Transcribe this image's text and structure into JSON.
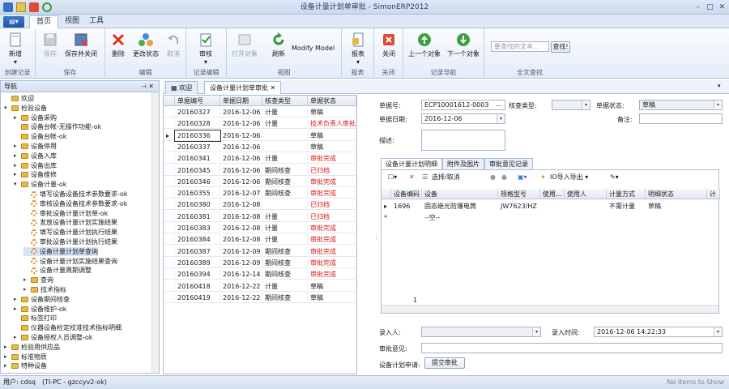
{
  "window": {
    "title": "设备计量计划单审批 - SimonERP2012"
  },
  "menu": {
    "tabs": [
      "首页",
      "视图",
      "工具"
    ]
  },
  "ribbon": {
    "groups": [
      {
        "title": "创建记录",
        "buttons": [
          {
            "label": "新增",
            "enabled": true,
            "icon": "new-doc-icon"
          }
        ]
      },
      {
        "title": "保存",
        "buttons": [
          {
            "label": "保存",
            "enabled": false,
            "icon": "floppy-icon"
          },
          {
            "label": "保存并关闭",
            "enabled": true,
            "icon": "save-close-icon"
          }
        ]
      },
      {
        "title": "编辑",
        "buttons": [
          {
            "label": "删除",
            "enabled": true,
            "icon": "delete-x-icon"
          },
          {
            "label": "更改状态",
            "enabled": true,
            "icon": "status-icon"
          },
          {
            "label": "取消",
            "enabled": false,
            "icon": "undo-icon"
          }
        ]
      },
      {
        "title": "记录编辑",
        "buttons": [
          {
            "label": "审核",
            "enabled": true,
            "icon": "audit-icon"
          }
        ]
      },
      {
        "title": "视图",
        "buttons": [
          {
            "label": "打开对象",
            "enabled": false,
            "icon": "open-object-icon"
          },
          {
            "label": "刷新",
            "enabled": true,
            "icon": "refresh-icon"
          },
          {
            "label": "Modify Model",
            "enabled": true,
            "icon": ""
          }
        ]
      },
      {
        "title": "报表",
        "buttons": [
          {
            "label": "报表",
            "enabled": true,
            "icon": "report-icon"
          }
        ]
      },
      {
        "title": "关闭",
        "buttons": [
          {
            "label": "关闭",
            "enabled": true,
            "icon": "close-red-icon"
          }
        ]
      },
      {
        "title": "记录导航",
        "buttons": [
          {
            "label": "上一个对象",
            "enabled": true,
            "icon": "up-arrow-icon"
          },
          {
            "label": "下一个对象",
            "enabled": true,
            "icon": "down-arrow-icon"
          }
        ]
      },
      {
        "title": "全文查找",
        "buttons": [
          {
            "label": "查找!",
            "enabled": true,
            "icon": ""
          }
        ]
      }
    ],
    "search_placeholder": "要查找的文本..."
  },
  "nav": {
    "title": "导航",
    "items": [
      {
        "label": "欢迎",
        "depth": 0,
        "kind": "folder",
        "exp": ""
      },
      {
        "label": "检验设备",
        "depth": 0,
        "kind": "folder",
        "exp": "▾"
      },
      {
        "label": "设备采购",
        "depth": 1,
        "kind": "folder",
        "exp": "▸"
      },
      {
        "label": "设备台帐-无操作功能-ok",
        "depth": 1,
        "kind": "folder",
        "exp": ""
      },
      {
        "label": "设备台帐-ok",
        "depth": 1,
        "kind": "folder",
        "exp": ""
      },
      {
        "label": "设备停用",
        "depth": 1,
        "kind": "folder",
        "exp": "▸"
      },
      {
        "label": "设备入库",
        "depth": 1,
        "kind": "folder",
        "exp": "▸"
      },
      {
        "label": "设备出库",
        "depth": 1,
        "kind": "folder",
        "exp": "▸"
      },
      {
        "label": "设备维修",
        "depth": 1,
        "kind": "folder",
        "exp": "▸"
      },
      {
        "label": "设备计量-ok",
        "depth": 1,
        "kind": "folder",
        "exp": "▾"
      },
      {
        "label": "填写设备设备技术参数要求-ok",
        "depth": 2,
        "kind": "gear",
        "exp": ""
      },
      {
        "label": "审核设备设备技术参数要求-ok",
        "depth": 2,
        "kind": "gear",
        "exp": ""
      },
      {
        "label": "审批设备计量计划单-ok",
        "depth": 2,
        "kind": "gear",
        "exp": ""
      },
      {
        "label": "发放设备计量计划实施结果",
        "depth": 2,
        "kind": "gear",
        "exp": ""
      },
      {
        "label": "填写设备计量计划执行结果",
        "depth": 2,
        "kind": "gear",
        "exp": ""
      },
      {
        "label": "审批设备计量计划执行结果",
        "depth": 2,
        "kind": "gear",
        "exp": ""
      },
      {
        "label": "设备计量计划单查询",
        "depth": 2,
        "kind": "gear",
        "exp": "",
        "selected": true
      },
      {
        "label": "设备计量计划实施结果查询",
        "depth": 2,
        "kind": "gear",
        "exp": ""
      },
      {
        "label": "设备计量周期调整",
        "depth": 2,
        "kind": "gear",
        "exp": ""
      },
      {
        "label": "查询",
        "depth": 2,
        "kind": "folder",
        "exp": "▸"
      },
      {
        "label": "技术指标",
        "depth": 2,
        "kind": "folder",
        "exp": "▸"
      },
      {
        "label": "设备期间核查",
        "depth": 1,
        "kind": "folder",
        "exp": "▸"
      },
      {
        "label": "设备维护-ok",
        "depth": 1,
        "kind": "folder",
        "exp": "▸"
      },
      {
        "label": "标签打印",
        "depth": 1,
        "kind": "folder",
        "exp": ""
      },
      {
        "label": "仪器设备检定校准技术指标明细",
        "depth": 1,
        "kind": "folder",
        "exp": ""
      },
      {
        "label": "设备授权人员调整-ok",
        "depth": 1,
        "kind": "folder",
        "exp": "▸"
      },
      {
        "label": "检验用供应品",
        "depth": 0,
        "kind": "folder",
        "exp": "▸"
      },
      {
        "label": "标准物质",
        "depth": 0,
        "kind": "folder",
        "exp": "▸"
      },
      {
        "label": "特种设备",
        "depth": 0,
        "kind": "folder",
        "exp": "▸"
      }
    ]
  },
  "doc_tabs": [
    {
      "label": "欢迎",
      "active": false
    },
    {
      "label": "设备计量计划单审批",
      "active": true
    }
  ],
  "grid": {
    "columns": [
      "单据编号",
      "单据日期",
      "核查类型",
      "单据状态"
    ],
    "rows": [
      [
        "20160327",
        "2016-12-06",
        "计量",
        "草稿"
      ],
      [
        "20160328",
        "2016-12-06",
        "计量",
        "技术负责人审批"
      ],
      [
        "20160336",
        "2016-12-06",
        "",
        "草稿"
      ],
      [
        "20160337",
        "2016-12-06",
        "",
        "草稿"
      ],
      [
        "20160341",
        "2016-12-06",
        "计量",
        "审批完成"
      ],
      [
        "20160345",
        "2016-12-06",
        "期间核查",
        "已归档"
      ],
      [
        "20160346",
        "2016-12-06",
        "期间核查",
        "审批完成"
      ],
      [
        "20160355",
        "2016-12-07",
        "期间核查",
        "审批完成"
      ],
      [
        "20160380",
        "2016-12-08",
        "",
        "已归档"
      ],
      [
        "20160381",
        "2016-12-08",
        "计量",
        "已归档"
      ],
      [
        "20160383",
        "2016-12-08",
        "计量",
        "审批完成"
      ],
      [
        "20160384",
        "2016-12-08",
        "计量",
        "审批完成"
      ],
      [
        "20160387",
        "2016-12-09",
        "期间核查",
        "审批完成"
      ],
      [
        "20160389",
        "2016-12-09",
        "期间核查",
        "审批完成"
      ],
      [
        "20160394",
        "2016-12-14",
        "期间核查",
        "审批完成"
      ],
      [
        "20160418",
        "2016-12-22",
        "计量",
        "草稿"
      ],
      [
        "20160419",
        "2016-12-22",
        "期间核查",
        "草稿"
      ]
    ],
    "red_statuses": [
      "技术负责人审批",
      "审批完成",
      "已归档"
    ],
    "selected_row": 2
  },
  "detail": {
    "doc_no_label": "单据号:",
    "doc_no": "ECP10001612-0003",
    "check_type_label": "核查类型:",
    "check_type": "",
    "status_label": "单据状态:",
    "status": "草稿",
    "date_label": "单据日期:",
    "date": "2016-12-06",
    "remark_label": "备注:",
    "remark": "",
    "desc_label": "描述:",
    "subtabs": [
      "设备计量计划明细",
      "附件及图片",
      "审批意见记录"
    ],
    "toolbar": {
      "select_cancel": "选择/取消",
      "io_import": "IO导入导出"
    },
    "sub_columns": [
      "设备编码",
      "设备",
      "规格型号",
      "使用...",
      "使用人",
      "计量方式",
      "明细状态",
      "计"
    ],
    "sub_rows": [
      [
        "1696",
        "固态继光防爆电筒",
        "JW7623/HZ",
        "",
        "",
        "不需计量",
        "草稿"
      ]
    ],
    "empty_row_text": "--空--",
    "footer_count": "1",
    "entry_user_label": "录入人:",
    "entry_user": "",
    "entry_time_label": "录入时间:",
    "entry_time": "2016-12-06 14:22:33",
    "approval_label": "审批意见:",
    "approval": "",
    "submit_label": "设备计划申请:",
    "submit_button": "提交审批"
  },
  "status": {
    "user": "用户: cdsq",
    "host": "(TI-PC - gzccyv2-ok)",
    "right": "No Items to Show"
  }
}
